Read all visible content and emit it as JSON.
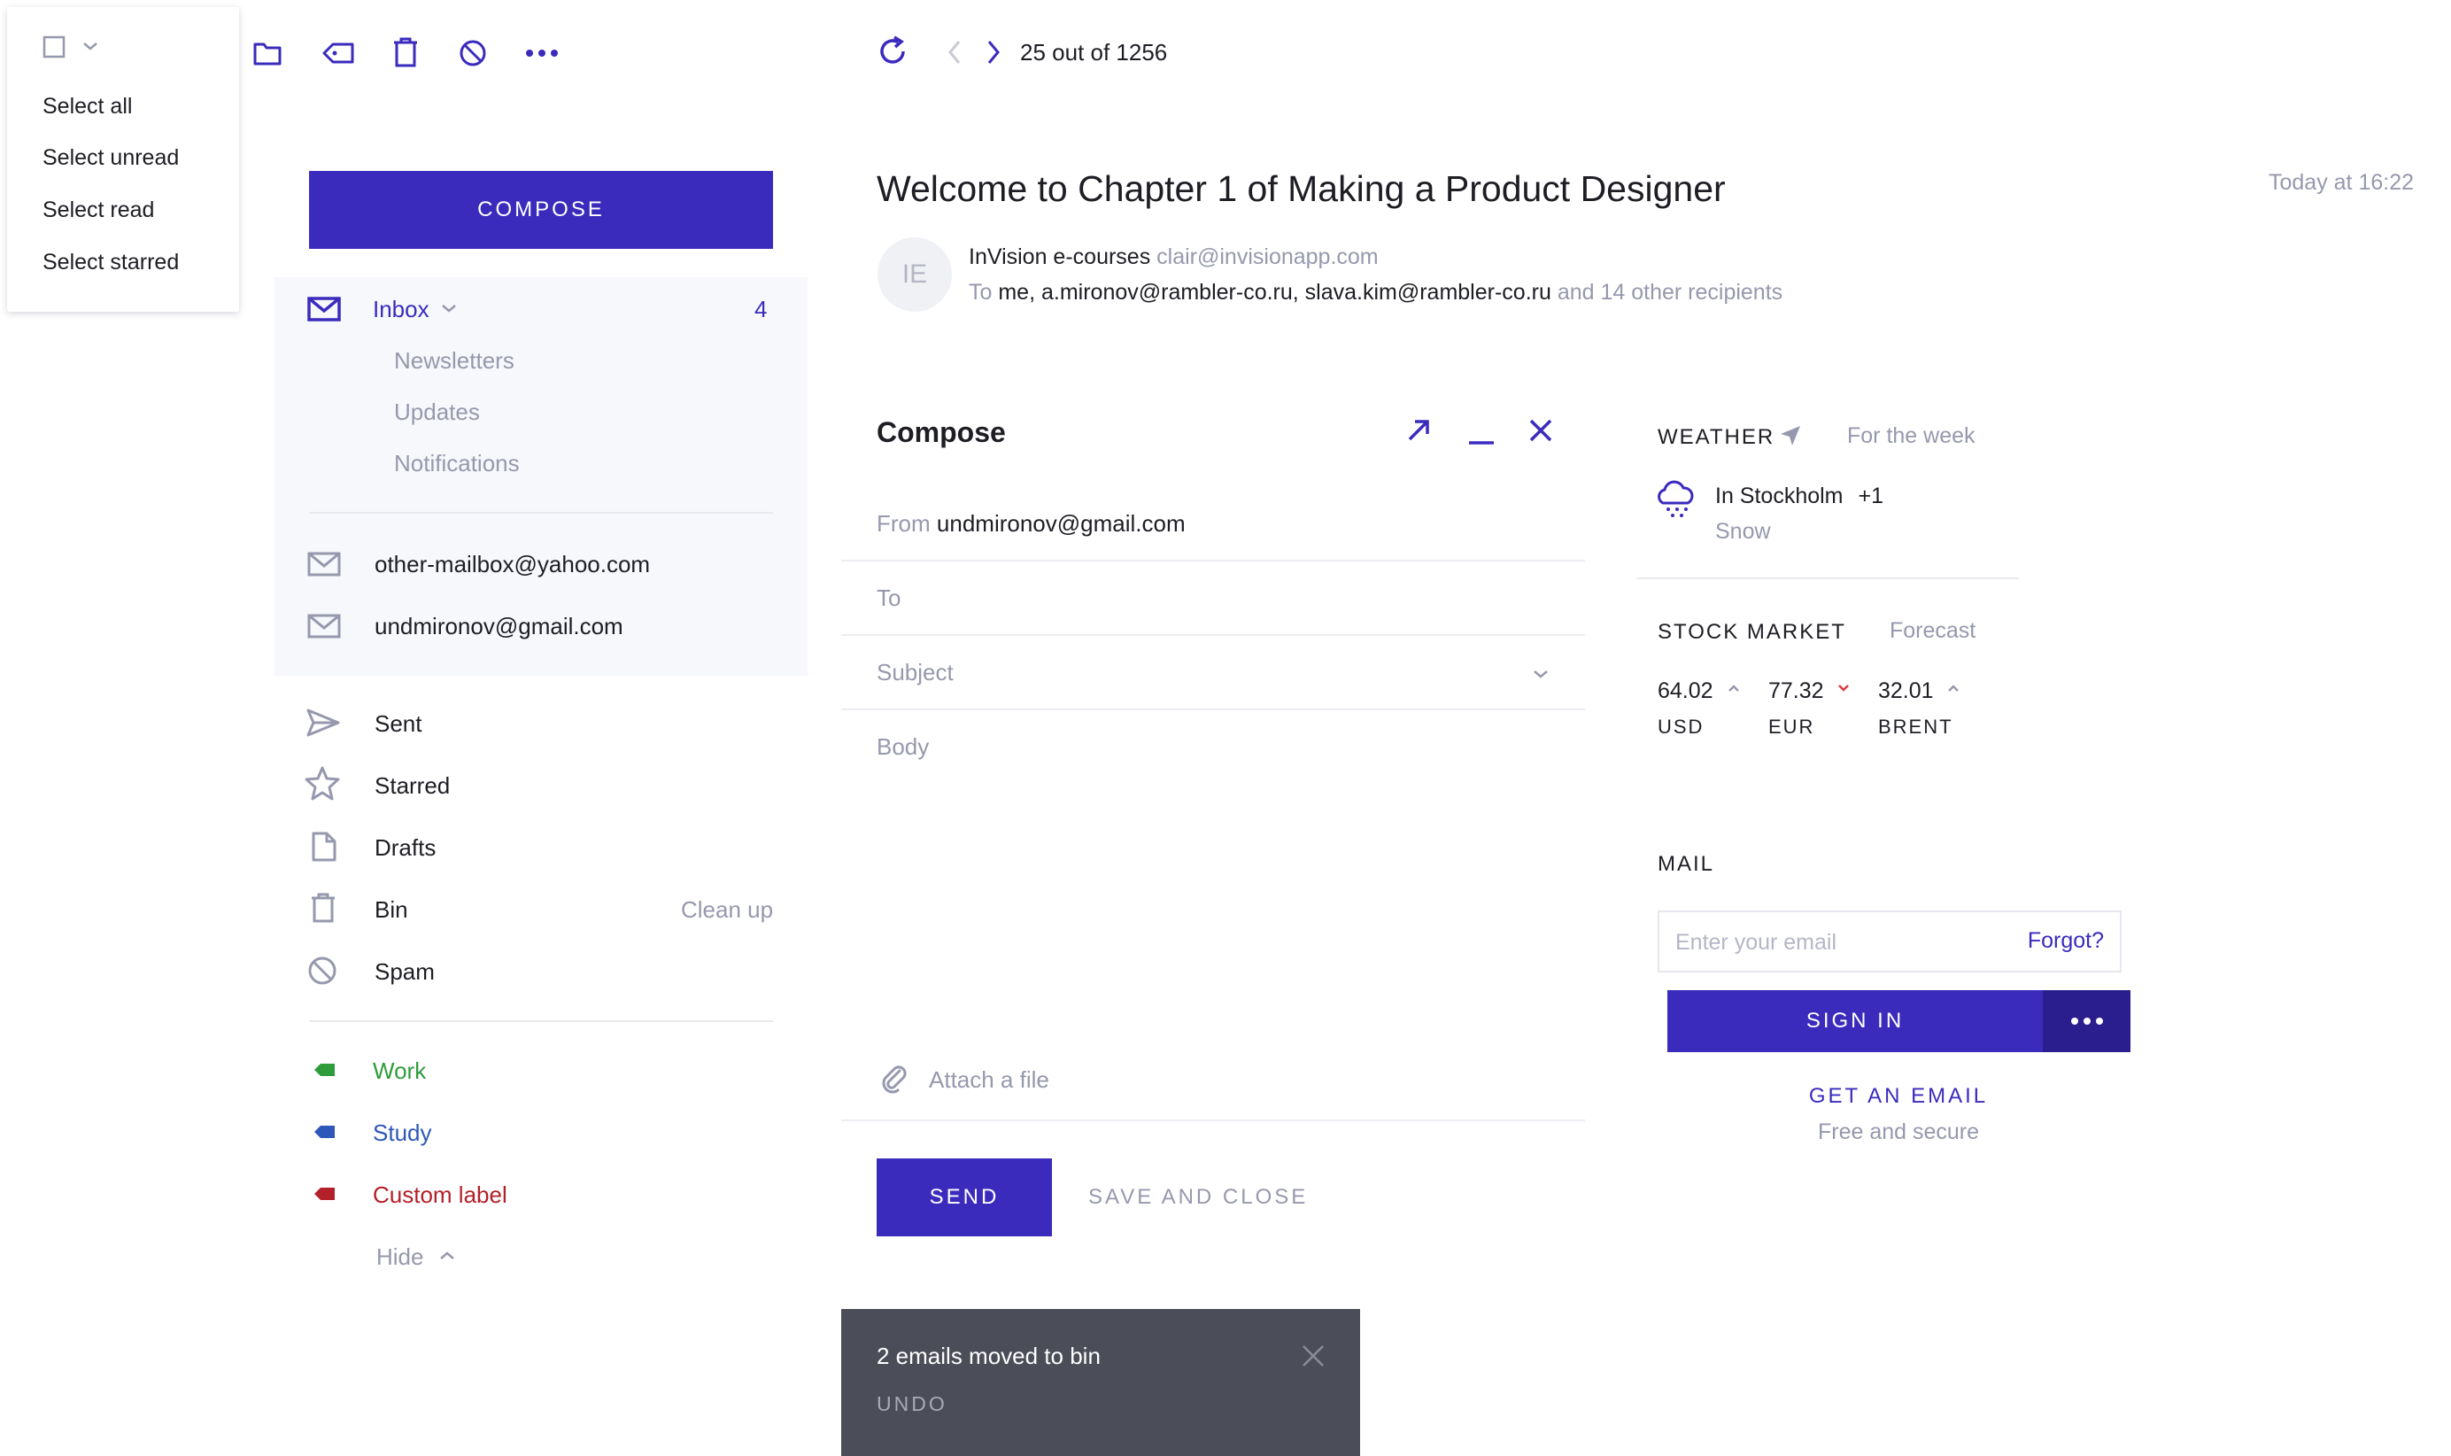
{
  "colors": {
    "accent": "#3a2bbd",
    "muted": "#9698ad",
    "work": "#2e9c3a",
    "study": "#2d57b8",
    "custom": "#b3202a",
    "toast": "#4b4d58"
  },
  "select_menu": {
    "items": [
      "Select all",
      "Select unread",
      "Select read",
      "Select starred"
    ]
  },
  "toolbar": {
    "icons": [
      "folder-icon",
      "label-icon",
      "trash-icon",
      "block-icon",
      "more-icon"
    ],
    "pagination": "25 out of 1256"
  },
  "sidebar": {
    "compose_label": "COMPOSE",
    "inbox": {
      "label": "Inbox",
      "count": "4",
      "subfolders": [
        "Newsletters",
        "Updates",
        "Notifications"
      ]
    },
    "accounts": [
      "other-mailbox@yahoo.com",
      "undmironov@gmail.com"
    ],
    "folders": [
      {
        "label": "Sent",
        "icon": "send-icon"
      },
      {
        "label": "Starred",
        "icon": "star-icon"
      },
      {
        "label": "Drafts",
        "icon": "draft-icon"
      },
      {
        "label": "Bin",
        "icon": "trash-icon",
        "action": "Clean up"
      },
      {
        "label": "Spam",
        "icon": "spam-icon"
      }
    ],
    "labels": [
      {
        "label": "Work",
        "color": "#2e9c3a"
      },
      {
        "label": "Study",
        "color": "#2d57b8"
      },
      {
        "label": "Custom label",
        "color": "#b3202a"
      }
    ],
    "hide_label": "Hide"
  },
  "email": {
    "subject": "Welcome to Chapter 1 of Making a Product Designer",
    "time": "Today at 16:22",
    "avatar_initials": "IE",
    "sender_name": "InVision e-courses",
    "sender_email": "clair@invisionapp.com",
    "to_prefix": "To",
    "recipients": "me, a.mironov@rambler-co.ru, slava.kim@rambler-co.ru",
    "others": "and 14 other recipients"
  },
  "compose": {
    "title": "Compose",
    "from_label": "From",
    "from_value": "undmironov@gmail.com",
    "to_label": "To",
    "subject_label": "Subject",
    "body_label": "Body",
    "attach_label": "Attach a file",
    "send_label": "SEND",
    "save_close_label": "SAVE AND CLOSE"
  },
  "toast": {
    "message": "2 emails moved to bin",
    "undo": "UNDO"
  },
  "weather": {
    "title": "WEATHER",
    "link": "For the week",
    "location": "In Stockholm",
    "temp": "+1",
    "condition": "Snow"
  },
  "stocks": {
    "title": "STOCK MARKET",
    "link": "Forecast",
    "items": [
      {
        "value": "64.02",
        "name": "USD",
        "trend": "up"
      },
      {
        "value": "77.32",
        "name": "EUR",
        "trend": "down"
      },
      {
        "value": "32.01",
        "name": "BRENT",
        "trend": "up"
      }
    ]
  },
  "mail_widget": {
    "title": "MAIL",
    "placeholder": "Enter your email",
    "forgot": "Forgot?",
    "sign_in": "SIGN IN",
    "get_email": "GET AN EMAIL",
    "get_email_sub": "Free and secure"
  }
}
